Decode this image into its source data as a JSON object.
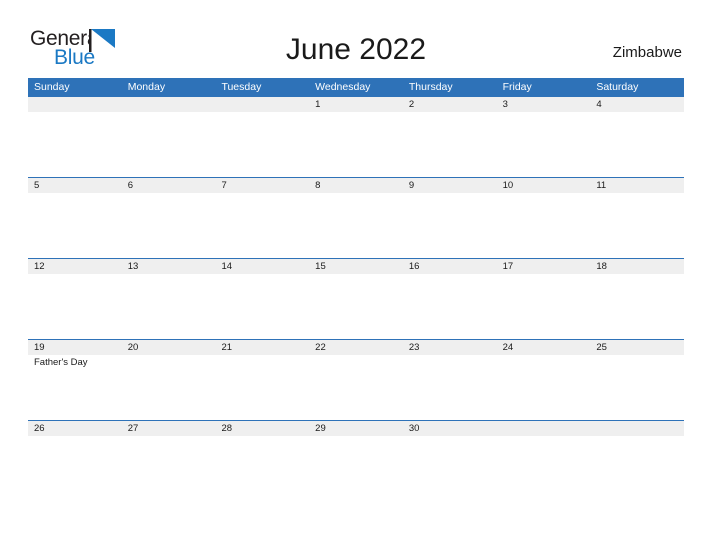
{
  "brand": {
    "name_part1": "General",
    "name_part2": "Blue",
    "flag_icon": "flag-triangle-icon",
    "colors": {
      "text_dark": "#231f20",
      "blue": "#1b79c4"
    }
  },
  "header": {
    "title": "June 2022",
    "region": "Zimbabwe"
  },
  "theme": {
    "header_blue": "#2e72b8",
    "band_gray": "#efefef",
    "text": "#1a1a1a"
  },
  "calendar": {
    "weekday_headers": [
      "Sunday",
      "Monday",
      "Tuesday",
      "Wednesday",
      "Thursday",
      "Friday",
      "Saturday"
    ],
    "weeks": [
      {
        "days": [
          {
            "num": "",
            "event": ""
          },
          {
            "num": "",
            "event": ""
          },
          {
            "num": "",
            "event": ""
          },
          {
            "num": "1",
            "event": ""
          },
          {
            "num": "2",
            "event": ""
          },
          {
            "num": "3",
            "event": ""
          },
          {
            "num": "4",
            "event": ""
          }
        ]
      },
      {
        "days": [
          {
            "num": "5",
            "event": ""
          },
          {
            "num": "6",
            "event": ""
          },
          {
            "num": "7",
            "event": ""
          },
          {
            "num": "8",
            "event": ""
          },
          {
            "num": "9",
            "event": ""
          },
          {
            "num": "10",
            "event": ""
          },
          {
            "num": "11",
            "event": ""
          }
        ]
      },
      {
        "days": [
          {
            "num": "12",
            "event": ""
          },
          {
            "num": "13",
            "event": ""
          },
          {
            "num": "14",
            "event": ""
          },
          {
            "num": "15",
            "event": ""
          },
          {
            "num": "16",
            "event": ""
          },
          {
            "num": "17",
            "event": ""
          },
          {
            "num": "18",
            "event": ""
          }
        ]
      },
      {
        "days": [
          {
            "num": "19",
            "event": "Father's Day"
          },
          {
            "num": "20",
            "event": ""
          },
          {
            "num": "21",
            "event": ""
          },
          {
            "num": "22",
            "event": ""
          },
          {
            "num": "23",
            "event": ""
          },
          {
            "num": "24",
            "event": ""
          },
          {
            "num": "25",
            "event": ""
          }
        ]
      },
      {
        "days": [
          {
            "num": "26",
            "event": ""
          },
          {
            "num": "27",
            "event": ""
          },
          {
            "num": "28",
            "event": ""
          },
          {
            "num": "29",
            "event": ""
          },
          {
            "num": "30",
            "event": ""
          },
          {
            "num": "",
            "event": ""
          },
          {
            "num": "",
            "event": ""
          }
        ]
      }
    ]
  }
}
